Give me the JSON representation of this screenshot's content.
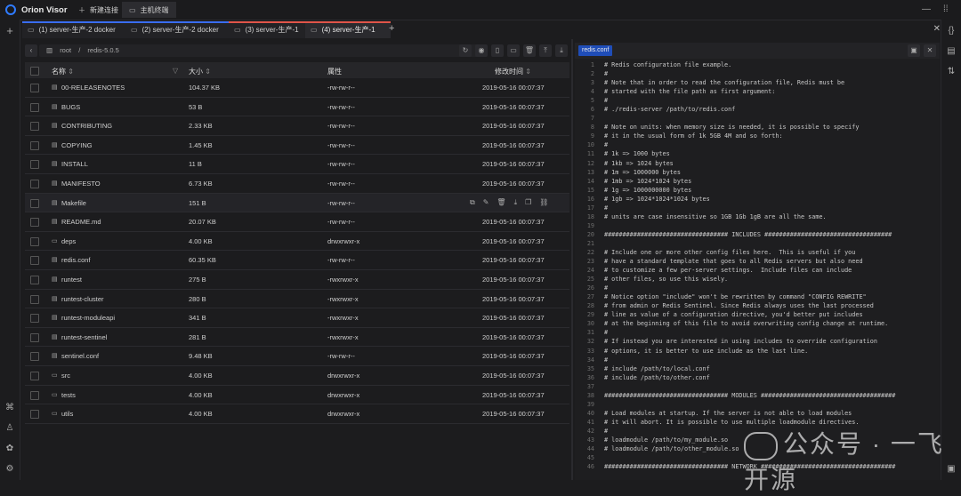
{
  "app": {
    "name": "Orion Visor"
  },
  "top_tabs": [
    {
      "label": "新建连接",
      "icon": "plus-icon"
    },
    {
      "label": "主机终端",
      "icon": "terminal-icon"
    }
  ],
  "session_tabs": [
    {
      "label": "(1) server-生产-2 docker",
      "color": "#3a6df0"
    },
    {
      "label": "(2) server-生产-2 docker",
      "color": "#3a6df0"
    },
    {
      "label": "(3) server-生产-1",
      "color": "#e0554a"
    },
    {
      "label": "(4) server-生产-1",
      "color": "#e0554a"
    }
  ],
  "path": {
    "segments": [
      "root",
      "/",
      "redis-5.0.5"
    ]
  },
  "table": {
    "headers": {
      "name": "名称",
      "size": "大小",
      "perm": "属性",
      "mtime": "修改时间"
    },
    "rows": [
      {
        "type": "file",
        "name": "00-RELEASENOTES",
        "size": "104.37 KB",
        "perm": "-rw-rw-r--",
        "mtime": "2019-05-16 00:07:37"
      },
      {
        "type": "file",
        "name": "BUGS",
        "size": "53 B",
        "perm": "-rw-rw-r--",
        "mtime": "2019-05-16 00:07:37"
      },
      {
        "type": "file",
        "name": "CONTRIBUTING",
        "size": "2.33 KB",
        "perm": "-rw-rw-r--",
        "mtime": "2019-05-16 00:07:37"
      },
      {
        "type": "file",
        "name": "COPYING",
        "size": "1.45 KB",
        "perm": "-rw-rw-r--",
        "mtime": "2019-05-16 00:07:37"
      },
      {
        "type": "file",
        "name": "INSTALL",
        "size": "11 B",
        "perm": "-rw-rw-r--",
        "mtime": "2019-05-16 00:07:37"
      },
      {
        "type": "file",
        "name": "MANIFESTO",
        "size": "6.73 KB",
        "perm": "-rw-rw-r--",
        "mtime": "2019-05-16 00:07:37"
      },
      {
        "type": "file",
        "name": "Makefile",
        "size": "151 B",
        "perm": "-rw-rw-r--",
        "mtime": ""
      },
      {
        "type": "file",
        "name": "README.md",
        "size": "20.07 KB",
        "perm": "-rw-rw-r--",
        "mtime": "2019-05-16 00:07:37"
      },
      {
        "type": "folder",
        "name": "deps",
        "size": "4.00 KB",
        "perm": "drwxrwxr-x",
        "mtime": "2019-05-16 00:07:37"
      },
      {
        "type": "file",
        "name": "redis.conf",
        "size": "60.35 KB",
        "perm": "-rw-rw-r--",
        "mtime": "2019-05-16 00:07:37"
      },
      {
        "type": "file",
        "name": "runtest",
        "size": "275 B",
        "perm": "-rwxrwxr-x",
        "mtime": "2019-05-16 00:07:37"
      },
      {
        "type": "file",
        "name": "runtest-cluster",
        "size": "280 B",
        "perm": "-rwxrwxr-x",
        "mtime": "2019-05-16 00:07:37"
      },
      {
        "type": "file",
        "name": "runtest-moduleapi",
        "size": "341 B",
        "perm": "-rwxrwxr-x",
        "mtime": "2019-05-16 00:07:37"
      },
      {
        "type": "file",
        "name": "runtest-sentinel",
        "size": "281 B",
        "perm": "-rwxrwxr-x",
        "mtime": "2019-05-16 00:07:37"
      },
      {
        "type": "file",
        "name": "sentinel.conf",
        "size": "9.48 KB",
        "perm": "-rw-rw-r--",
        "mtime": "2019-05-16 00:07:37"
      },
      {
        "type": "folder",
        "name": "src",
        "size": "4.00 KB",
        "perm": "drwxrwxr-x",
        "mtime": "2019-05-16 00:07:37"
      },
      {
        "type": "folder",
        "name": "tests",
        "size": "4.00 KB",
        "perm": "drwxrwxr-x",
        "mtime": "2019-05-16 00:07:37"
      },
      {
        "type": "folder",
        "name": "utils",
        "size": "4.00 KB",
        "perm": "drwxrwxr-x",
        "mtime": "2019-05-16 00:07:37"
      }
    ]
  },
  "editor": {
    "tab_label": "redis.conf",
    "lines": [
      "# Redis configuration file example.",
      "#",
      "# Note that in order to read the configuration file, Redis must be",
      "# started with the file path as first argument:",
      "#",
      "# ./redis-server /path/to/redis.conf",
      "",
      "# Note on units: when memory size is needed, it is possible to specify",
      "# it in the usual form of 1k 5GB 4M and so forth:",
      "#",
      "# 1k => 1000 bytes",
      "# 1kb => 1024 bytes",
      "# 1m => 1000000 bytes",
      "# 1mb => 1024*1024 bytes",
      "# 1g => 1000000000 bytes",
      "# 1gb => 1024*1024*1024 bytes",
      "#",
      "# units are case insensitive so 1GB 1Gb 1gB are all the same.",
      "",
      "################################## INCLUDES ###################################",
      "",
      "# Include one or more other config files here.  This is useful if you",
      "# have a standard template that goes to all Redis servers but also need",
      "# to customize a few per-server settings.  Include files can include",
      "# other files, so use this wisely.",
      "#",
      "# Notice option \"include\" won't be rewritten by command \"CONFIG REWRITE\"",
      "# from admin or Redis Sentinel. Since Redis always uses the last processed",
      "# line as value of a configuration directive, you'd better put includes",
      "# at the beginning of this file to avoid overwriting config change at runtime.",
      "#",
      "# If instead you are interested in using includes to override configuration",
      "# options, it is better to use include as the last line.",
      "#",
      "# include /path/to/local.conf",
      "# include /path/to/other.conf",
      "",
      "################################## MODULES #####################################",
      "",
      "# Load modules at startup. If the server is not able to load modules",
      "# it will abort. It is possible to use multiple loadmodule directives.",
      "#",
      "# loadmodule /path/to/my_module.so",
      "# loadmodule /path/to/other_module.so",
      "",
      "################################## NETWORK #####################################"
    ]
  },
  "watermark": "公众号 · 一飞开源"
}
